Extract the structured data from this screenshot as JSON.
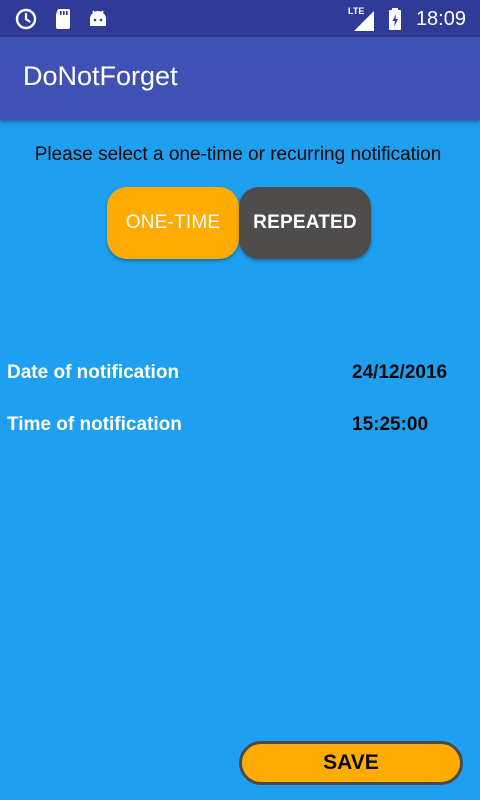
{
  "status_bar": {
    "time": "18:09",
    "network": "LTE",
    "icons": [
      "clock-icon",
      "sd-card-icon",
      "android-icon",
      "signal-icon",
      "battery-icon"
    ]
  },
  "app_bar": {
    "title": "DoNotForget"
  },
  "prompt": "Please select a one-time or recurring notification",
  "toggle": {
    "one_time_label": "ONE-TIME",
    "repeated_label": "REPEATED",
    "selected": "ONE-TIME"
  },
  "fields": {
    "date_label": "Date of notification",
    "date_value": "24/12/2016",
    "time_label": "Time of notification",
    "time_value": "15:25:00"
  },
  "save_label": "SAVE",
  "colors": {
    "background": "#1e9ff0",
    "app_bar": "#3f51b5",
    "status_bar": "#2f3b97",
    "accent": "#ffab00",
    "repeated_button": "#4f4c4c"
  }
}
